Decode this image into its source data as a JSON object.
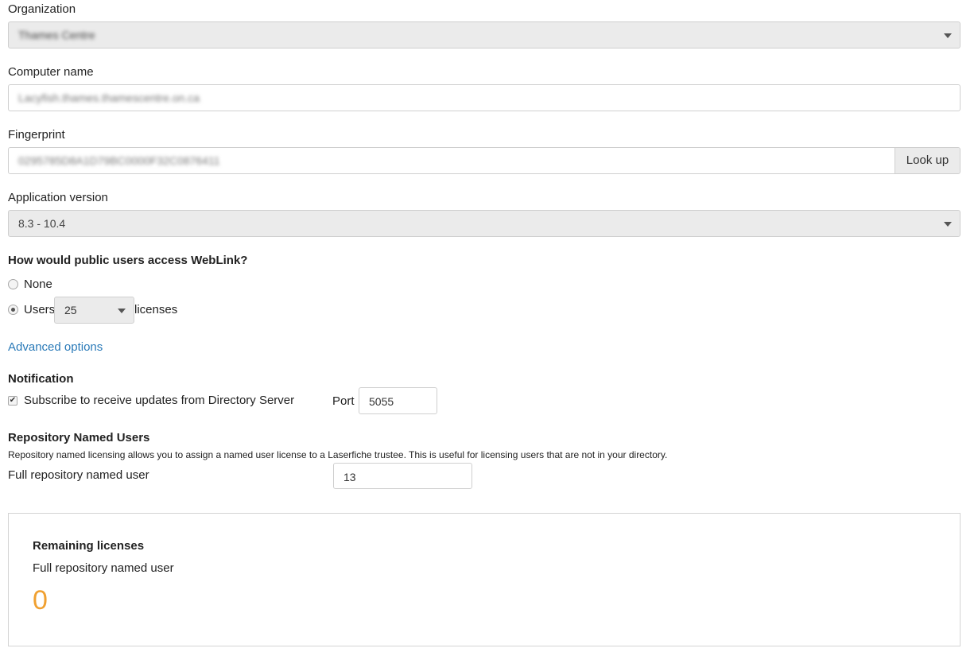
{
  "organization": {
    "label": "Organization",
    "value": "Thames Centre"
  },
  "computer_name": {
    "label": "Computer name",
    "value": "Lacyfish.thames.thamescentre.on.ca"
  },
  "fingerprint": {
    "label": "Fingerprint",
    "value": "0295785D8A1D79BC0000F32C0876411",
    "lookup_label": "Look up"
  },
  "app_version": {
    "label": "Application version",
    "value": "8.3 - 10.4"
  },
  "public_access": {
    "question": "How would public users access WebLink?",
    "option_none": "None",
    "option_users": "Users",
    "users_count": "25",
    "licenses_label": "licenses",
    "selected": "users"
  },
  "advanced_options": "Advanced options",
  "notification": {
    "heading": "Notification",
    "subscribe_label": "Subscribe to receive updates from Directory Server",
    "subscribe_checked": true,
    "port_label": "Port",
    "port_value": "5055"
  },
  "repo_named_users": {
    "heading": "Repository Named Users",
    "description": "Repository named licensing allows you to assign a named user license to a Laserfiche trustee. This is useful for licensing users that are not in your directory.",
    "full_label": "Full repository named user",
    "full_value": "13"
  },
  "remaining": {
    "heading": "Remaining licenses",
    "full_label": "Full repository named user",
    "full_count": "0",
    "count_color": "#f0a030"
  }
}
